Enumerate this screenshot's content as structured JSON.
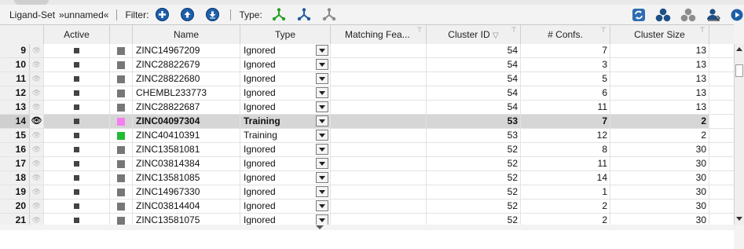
{
  "toolbar": {
    "ligand_set_label": "Ligand-Set",
    "ligand_set_name": "»unnamed«",
    "filter_label": "Filter:",
    "type_label": "Type:"
  },
  "columns": [
    "Active",
    "Name",
    "Type",
    "Matching Fea...",
    "Cluster ID",
    "# Confs.",
    "Cluster Size"
  ],
  "colors": {
    "accent": "#1f5fa8",
    "training_pink": "#f57ef0",
    "training_green": "#22bb33",
    "ignored_gray": "#777777",
    "selected_row": "#d6d6d6"
  },
  "rows": [
    {
      "num": "9",
      "color": "#777777",
      "name": "ZINC14967209",
      "type": "Ignored",
      "cluster_id": "54",
      "confs": "7",
      "cluster_size": "13",
      "visible": false
    },
    {
      "num": "10",
      "color": "#777777",
      "name": "ZINC28822679",
      "type": "Ignored",
      "cluster_id": "54",
      "confs": "3",
      "cluster_size": "13",
      "visible": false
    },
    {
      "num": "11",
      "color": "#777777",
      "name": "ZINC28822680",
      "type": "Ignored",
      "cluster_id": "54",
      "confs": "5",
      "cluster_size": "13",
      "visible": false
    },
    {
      "num": "12",
      "color": "#777777",
      "name": "CHEMBL233773",
      "type": "Ignored",
      "cluster_id": "54",
      "confs": "6",
      "cluster_size": "13",
      "visible": false
    },
    {
      "num": "13",
      "color": "#777777",
      "name": "ZINC28822687",
      "type": "Ignored",
      "cluster_id": "54",
      "confs": "11",
      "cluster_size": "13",
      "visible": false
    },
    {
      "num": "14",
      "color": "#f57ef0",
      "name": "ZINC04097304",
      "type": "Training",
      "cluster_id": "53",
      "confs": "7",
      "cluster_size": "2",
      "visible": true,
      "selected": true
    },
    {
      "num": "15",
      "color": "#22bb33",
      "name": "ZINC40410391",
      "type": "Training",
      "cluster_id": "53",
      "confs": "12",
      "cluster_size": "2",
      "visible": false
    },
    {
      "num": "16",
      "color": "#777777",
      "name": "ZINC13581081",
      "type": "Ignored",
      "cluster_id": "52",
      "confs": "8",
      "cluster_size": "30",
      "visible": false
    },
    {
      "num": "17",
      "color": "#777777",
      "name": "ZINC03814384",
      "type": "Ignored",
      "cluster_id": "52",
      "confs": "11",
      "cluster_size": "30",
      "visible": false
    },
    {
      "num": "18",
      "color": "#777777",
      "name": "ZINC13581085",
      "type": "Ignored",
      "cluster_id": "52",
      "confs": "14",
      "cluster_size": "30",
      "visible": false
    },
    {
      "num": "19",
      "color": "#777777",
      "name": "ZINC14967330",
      "type": "Ignored",
      "cluster_id": "52",
      "confs": "1",
      "cluster_size": "30",
      "visible": false
    },
    {
      "num": "20",
      "color": "#777777",
      "name": "ZINC03814404",
      "type": "Ignored",
      "cluster_id": "52",
      "confs": "2",
      "cluster_size": "30",
      "visible": false
    },
    {
      "num": "21",
      "color": "#777777",
      "name": "ZINC13581075",
      "type": "Ignored",
      "cluster_id": "52",
      "confs": "2",
      "cluster_size": "30",
      "visible": false
    }
  ]
}
